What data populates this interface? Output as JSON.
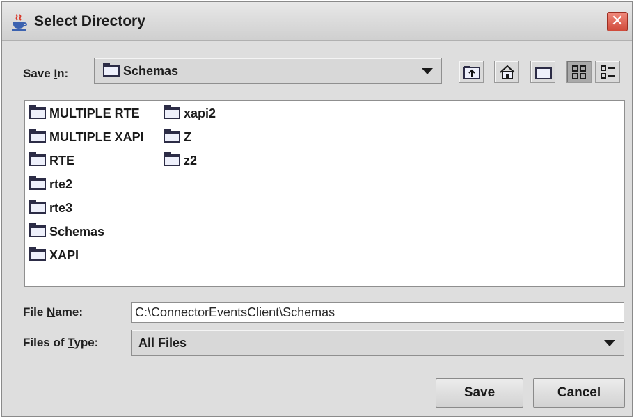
{
  "window": {
    "title": "Select Directory",
    "close_glyph": "✕"
  },
  "save_in": {
    "label_prefix": "Save ",
    "label_mnemonic": "I",
    "label_suffix": "n:",
    "value": "Schemas"
  },
  "toolbar": {
    "icons": [
      "up-folder-icon",
      "home-icon",
      "new-folder-icon",
      "list-view-icon",
      "details-view-icon"
    ]
  },
  "files": {
    "column1": [
      "MULTIPLE RTE",
      "MULTIPLE XAPI",
      "RTE",
      "rte2",
      "rte3",
      "Schemas",
      "XAPI"
    ],
    "column2": [
      "xapi2",
      "Z",
      "z2"
    ]
  },
  "file_name": {
    "label_prefix": "File ",
    "label_mnemonic": "N",
    "label_suffix": "ame:",
    "value": "C:\\ConnectorEventsClient\\Schemas"
  },
  "file_type": {
    "label_prefix": "Files of ",
    "label_mnemonic": "T",
    "label_suffix": "ype:",
    "value": "All Files"
  },
  "buttons": {
    "save": "Save",
    "cancel": "Cancel"
  },
  "colors": {
    "dialog_bg": "#dedede",
    "close_red": "#d04a3a",
    "folder_outline": "#2c2c46"
  }
}
